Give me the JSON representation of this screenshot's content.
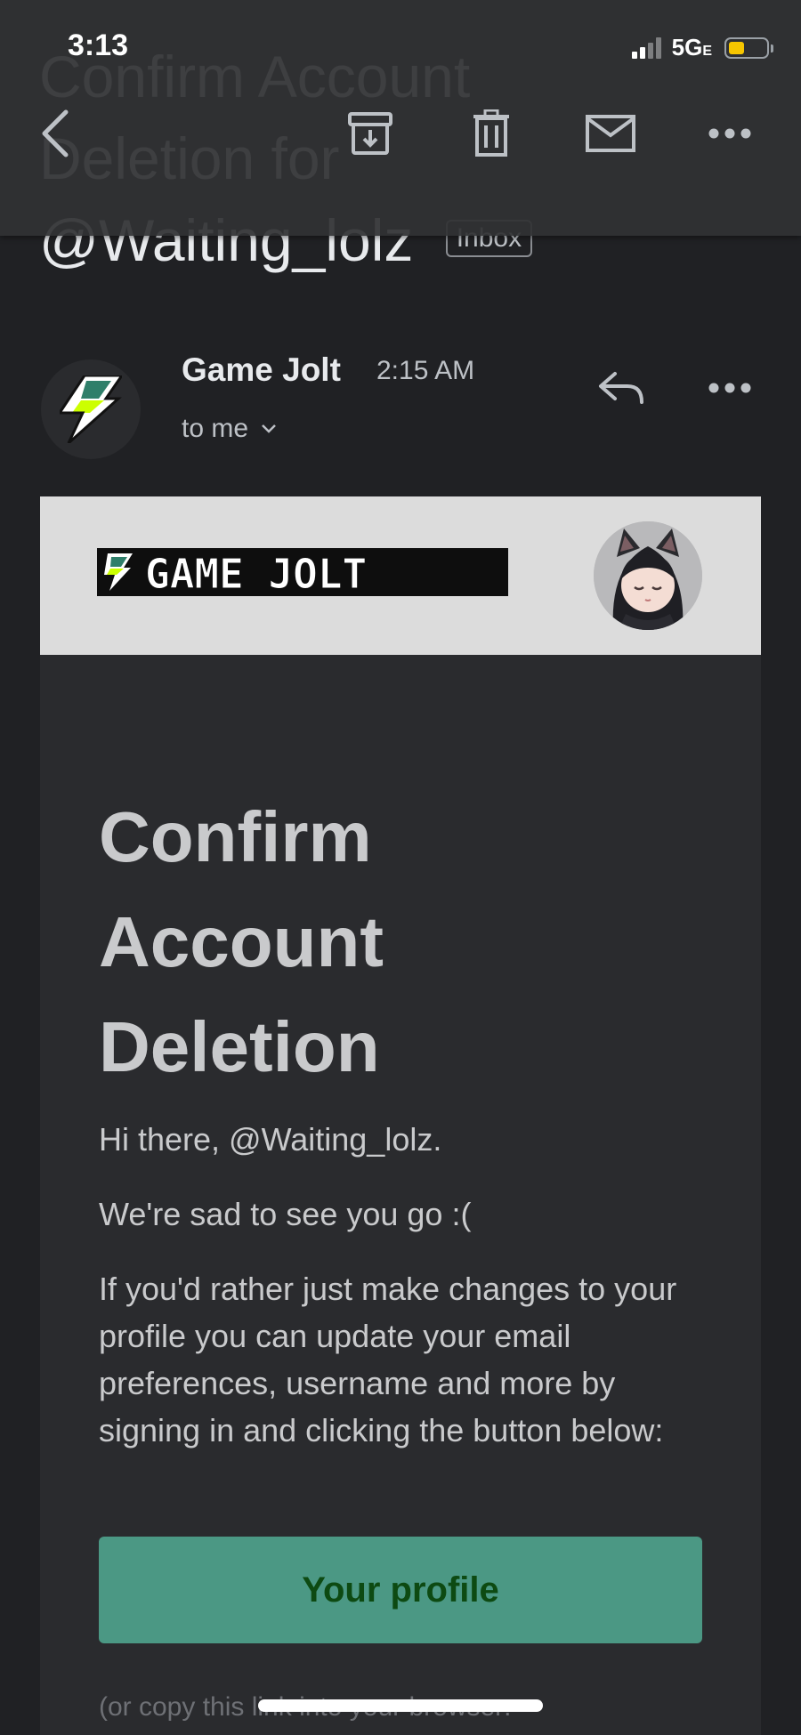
{
  "status_bar": {
    "time": "3:13",
    "network": "5G",
    "network_suffix": "E",
    "battery_color": "#f7c600"
  },
  "toolbar": {
    "back_icon": "chevron-left-icon",
    "archive_icon": "archive-icon",
    "delete_icon": "trash-icon",
    "mark_unread_icon": "mail-icon",
    "more_icon": "more-horizontal-icon"
  },
  "subject": {
    "title": "Confirm Account Deletion for @Waiting_lolz",
    "label": "Inbox"
  },
  "message": {
    "sender": "Game Jolt",
    "time": "2:15 AM",
    "recipient": "to me",
    "reply_icon": "reply-icon",
    "more_icon": "more-horizontal-icon"
  },
  "email": {
    "logo_text": "GAME JOLT",
    "title": "Confirm Account Deletion",
    "greeting": "Hi there, @Waiting_lolz.",
    "sad_line": "We're sad to see you go :(",
    "body": "If you'd rather just make changes to your profile you can update your email preferences, username and more by signing in and clicking the button below:",
    "button_label": "Your profile",
    "footnote": "(or copy this link into your browser:",
    "accent_color": "#4b9884",
    "button_text_color": "#0d4a12"
  }
}
